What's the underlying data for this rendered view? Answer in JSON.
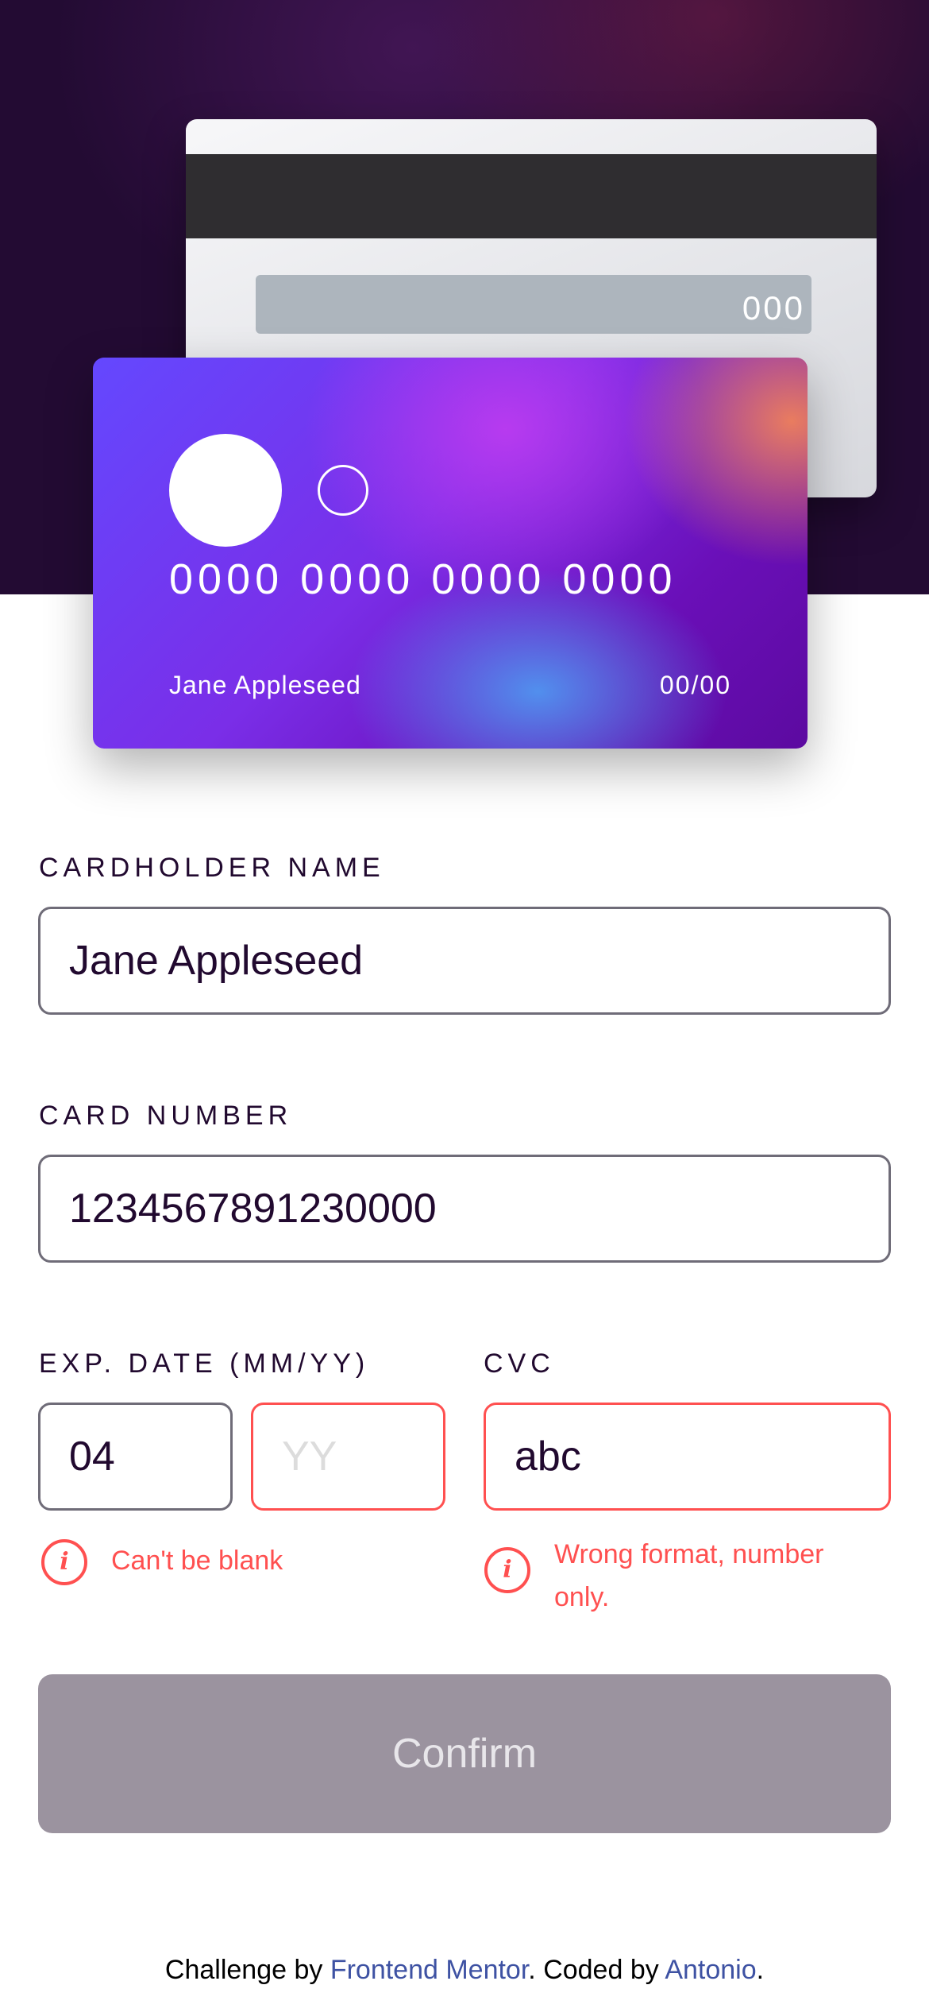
{
  "card_back": {
    "cvc": "000"
  },
  "card_front": {
    "number": "0000 0000 0000 0000",
    "name": "Jane Appleseed",
    "expiry": "00/00"
  },
  "form": {
    "cardholder": {
      "label": "CARDHOLDER NAME",
      "value": "Jane Appleseed"
    },
    "number": {
      "label": "CARD NUMBER",
      "value": "1234567891230000"
    },
    "expiry": {
      "label": "EXP. DATE (MM/YY)",
      "month_value": "04",
      "year_placeholder": "YY",
      "error": "Can't be blank"
    },
    "cvc": {
      "label": "CVC",
      "value": "abc",
      "error_line1": "Wrong format, number",
      "error_line2": "only."
    },
    "confirm_label": "Confirm"
  },
  "footer": {
    "prefix": "Challenge by ",
    "link1": "Frontend Mentor",
    "middle": ". Coded by ",
    "link2": "Antonio",
    "suffix": "."
  },
  "colors": {
    "error": "#ff5050",
    "dark": "#21092f",
    "button_disabled": "#9b939f",
    "link": "#3e52a3"
  },
  "icons": {
    "error": "info-icon"
  }
}
